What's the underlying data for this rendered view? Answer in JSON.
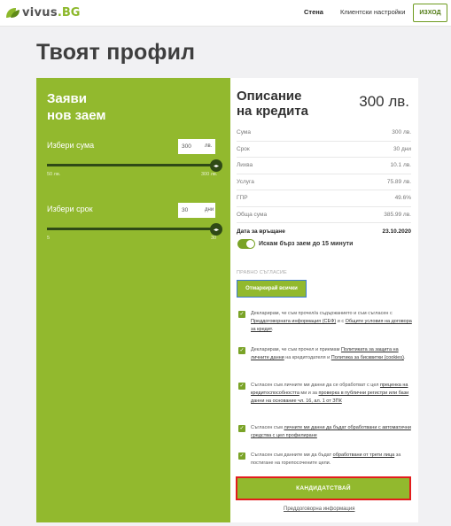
{
  "header": {
    "logo_text": "vivus",
    "logo_tld": ".BG",
    "nav": [
      {
        "label": "Стена",
        "active": true
      },
      {
        "label": "Клиентски настройки",
        "active": false
      }
    ],
    "logout_label": "ИЗХОД"
  },
  "page_title": "Твоят профил",
  "loan_form": {
    "title_line1": "Заяви",
    "title_line2": "нов заем",
    "amount": {
      "label": "Избери сума",
      "value": "300",
      "unit": "лв.",
      "min_label": "50 лв.",
      "max_label": "300 лв.",
      "level": 1.0
    },
    "term": {
      "label": "Избери срок",
      "value": "30",
      "unit": "дни",
      "min_label": "5",
      "max_label": "30",
      "level": 1.0
    }
  },
  "description": {
    "title_line1": "Описание",
    "title_line2": "на кредита",
    "amount": "300 лв.",
    "rows": [
      {
        "label": "Сума",
        "value": "300 лв."
      },
      {
        "label": "Срок",
        "value": "30 дни"
      },
      {
        "label": "Лихва",
        "value": "10.1 лв."
      },
      {
        "label": "Услуга",
        "value": "75.89 лв."
      },
      {
        "label": "ГПР",
        "value": "49.6%"
      },
      {
        "label": "Обща сума",
        "value": "385.99 лв."
      }
    ],
    "return_date": {
      "label": "Дата за връщане",
      "value": "23.10.2020"
    },
    "fast_loan_label": "Искам бърз заем до 15 минути"
  },
  "legal": {
    "heading": "ПРАВНО СЪГЛАСИЕ",
    "mark_all_label": "Отмаркирай всички",
    "consents": [
      {
        "parts": [
          {
            "t": "Декларирам, че съм прочел/а съдържанието и съм съгласен с "
          },
          {
            "t": "Преддоговорната информация (СЕФ)",
            "link": true
          },
          {
            "t": " и с "
          },
          {
            "t": "Общите условия на договора за кредит",
            "link": true
          },
          {
            "t": "."
          }
        ]
      },
      {
        "parts": [
          {
            "t": "Декларирам, че съм прочел и приемам "
          },
          {
            "t": "Политиката за защита на личните данни",
            "link": true
          },
          {
            "t": " на кредитодателя и "
          },
          {
            "t": "Политика за бисквитки (cookies)",
            "link": true
          },
          {
            "t": "."
          }
        ]
      },
      {
        "parts": [
          {
            "t": "Съгласен съм личните ми данни да се обработват с цел "
          },
          {
            "t": "преценка на кредитоспособността",
            "link": true
          },
          {
            "t": " ми и за "
          },
          {
            "t": "проверка в публични регистри или бази данни на основание чл. 16, ал. 1 от ЗПК",
            "link": true
          }
        ]
      },
      {
        "parts": [
          {
            "t": "Съгласен съм "
          },
          {
            "t": "личните ми данни да бъдат обработвани с автоматични средства с цел профилиране",
            "link": true
          }
        ]
      },
      {
        "parts": [
          {
            "t": "Съгласен съм данните ми да бъдат "
          },
          {
            "t": "обработвани от трети лица",
            "link": true
          },
          {
            "t": " за постигане на горепосочените цели."
          }
        ]
      }
    ],
    "apply_label": "КАНДИДАТСТВАЙ",
    "precontract_link": "Преддоговорна информация"
  },
  "colors": {
    "brand_green": "#92b92e",
    "dark_green": "#2f4a16",
    "highlight_red": "#e21d1d"
  }
}
